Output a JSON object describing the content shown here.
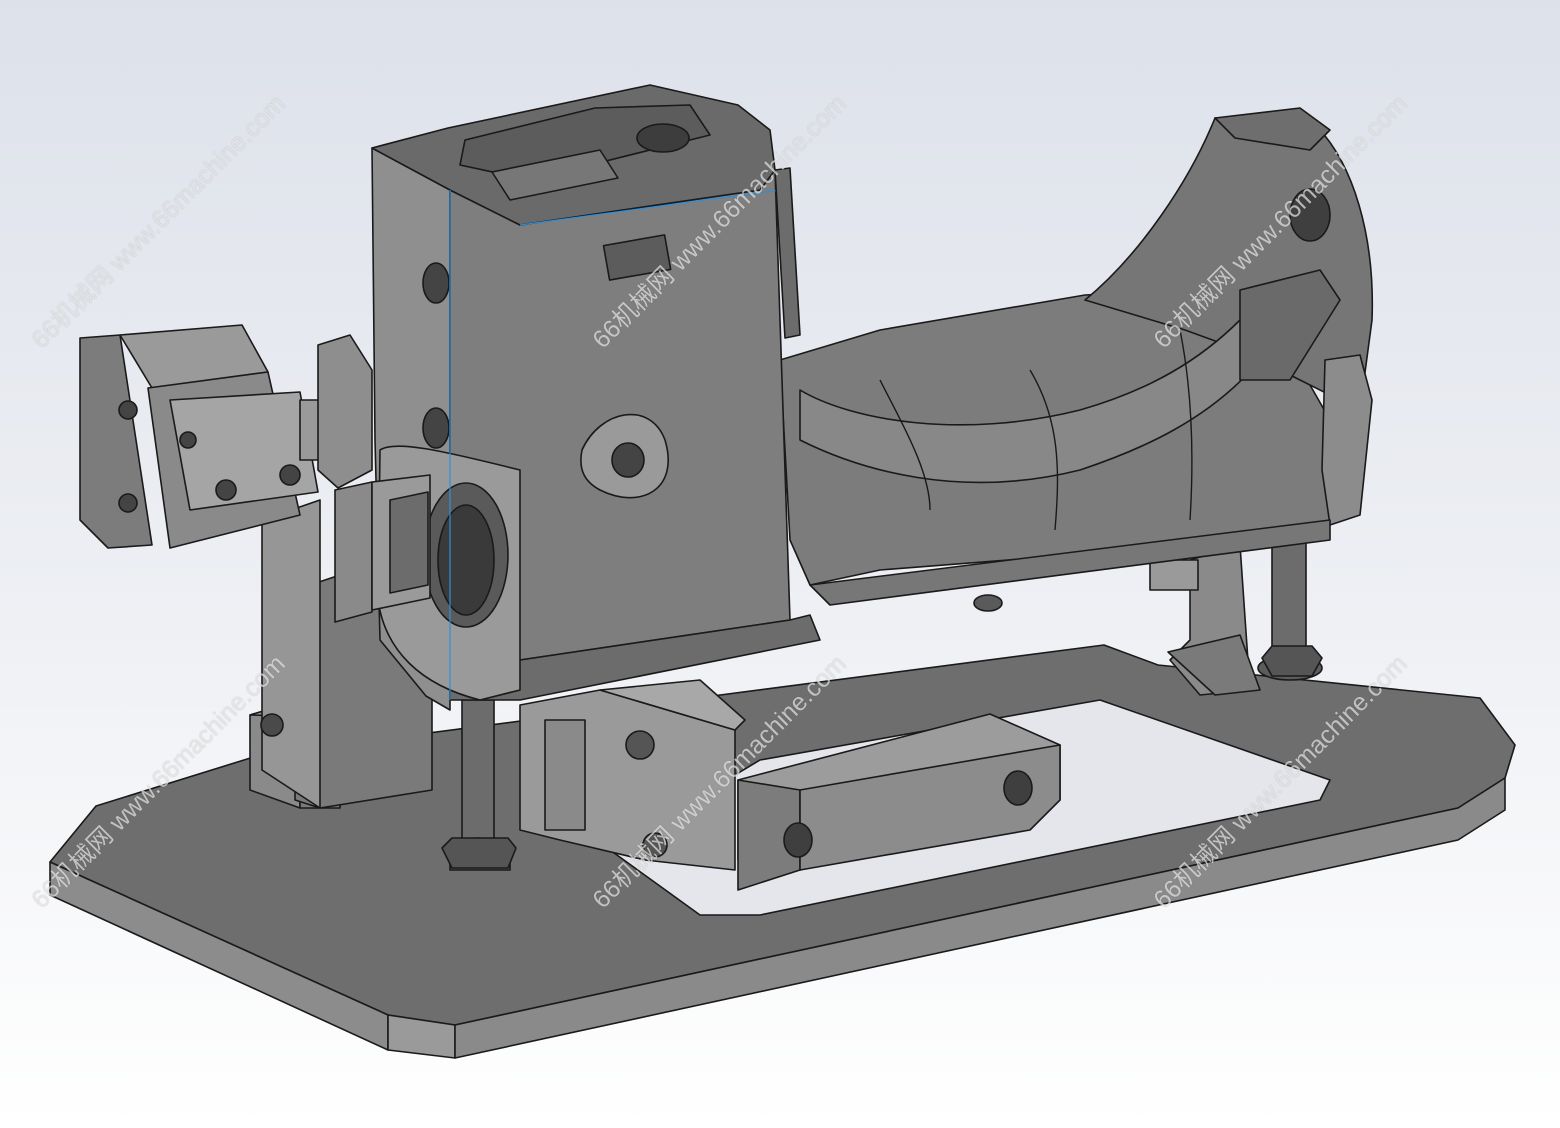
{
  "viewport": {
    "background_top": "#dde1ea",
    "background_bottom": "#ffffff",
    "model": {
      "face_color": "#7a7a7a",
      "face_dark": "#5f5f5f",
      "face_light": "#9a9a9a",
      "edge_color": "#1a1a1a",
      "highlight_edge": "#2f8fd8",
      "parts": [
        "base-plate",
        "machine-head-body",
        "curved-arm",
        "left-cylinder",
        "bottom-cylinder",
        "front-bracket",
        "support-posts",
        "hex-nuts"
      ]
    }
  },
  "watermarks": {
    "text": "66机械网 www.66machine.com",
    "count": 6
  }
}
